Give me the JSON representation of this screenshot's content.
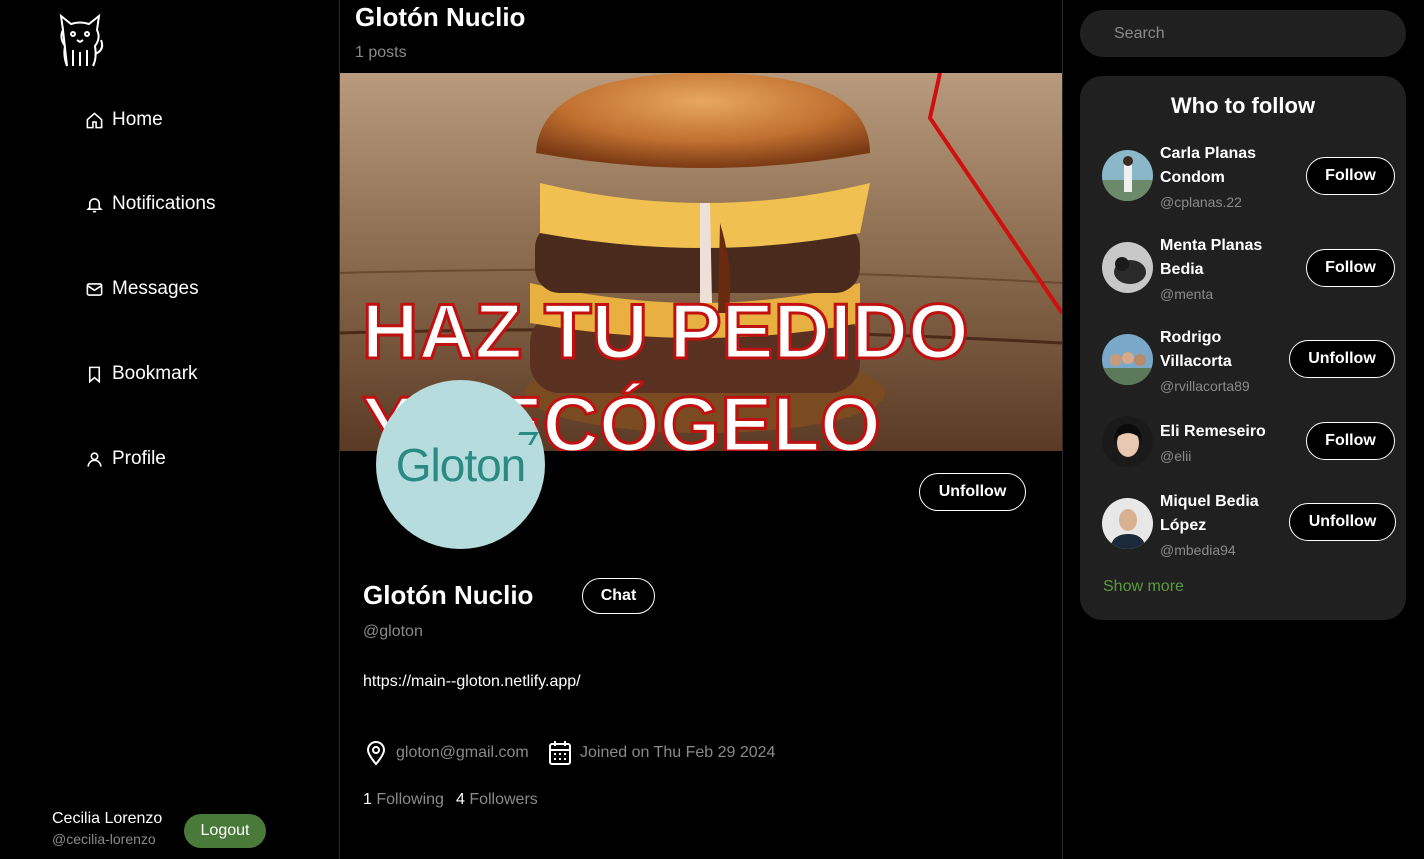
{
  "sidebar": {
    "logo_icon": "cat-logo-icon",
    "items": [
      {
        "label": "Home",
        "icon": "home-icon"
      },
      {
        "label": "Notifications",
        "icon": "bell-icon"
      },
      {
        "label": "Messages",
        "icon": "mail-icon"
      },
      {
        "label": "Bookmark",
        "icon": "bookmark-icon"
      },
      {
        "label": "Profile",
        "icon": "user-icon"
      }
    ],
    "current_user": {
      "name": "Cecilia Lorenzo",
      "handle": "@cecilia-lorenzo"
    },
    "logout_label": "Logout"
  },
  "main": {
    "title": "Glotón Nuclio",
    "posts_count": "1 posts",
    "banner": {
      "text_line1": "HAZ TU PEDIDO",
      "text_line2": "Y RECÓGELO"
    },
    "avatar_text": "Gloton",
    "unfollow_label": "Unfollow",
    "profile": {
      "name": "Glotón Nuclio",
      "chat_label": "Chat",
      "handle": "@gloton",
      "link": "https://main--gloton.netlify.app/",
      "email": "gloton@gmail.com",
      "joined": "Joined on Thu Feb 29 2024",
      "following_count": "1",
      "following_label": "Following",
      "followers_count": "4",
      "followers_label": "Followers"
    }
  },
  "right": {
    "search_placeholder": "Search",
    "who_to_follow_title": "Who to follow",
    "suggestions": [
      {
        "name": "Carla Planas Condom",
        "handle": "@cplanas.22",
        "button": "Follow"
      },
      {
        "name": "Menta Planas Bedia",
        "handle": "@menta",
        "button": "Follow"
      },
      {
        "name": "Rodrigo Villacorta",
        "handle": "@rvillacorta89",
        "button": "Unfollow"
      },
      {
        "name": "Eli Remeseiro",
        "handle": "@elii",
        "button": "Follow"
      },
      {
        "name": "Miquel Bedia López",
        "handle": "@mbedia94",
        "button": "Unfollow"
      }
    ],
    "show_more_label": "Show more"
  },
  "colors": {
    "accent_green": "#4a7a3a",
    "link_green": "#5a9a3e",
    "panel": "#202020"
  }
}
